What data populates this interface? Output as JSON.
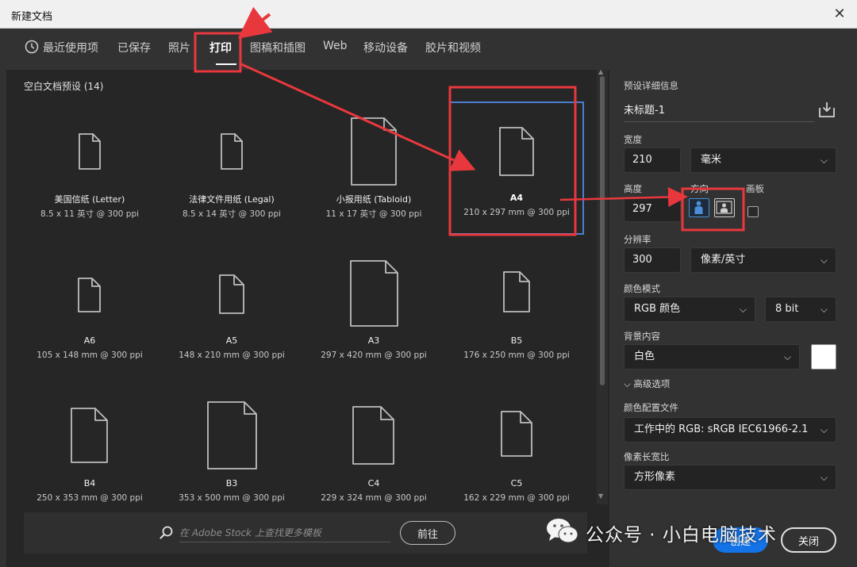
{
  "window": {
    "title": "新建文档",
    "close_glyph": "✕"
  },
  "tabs": [
    {
      "label": "最近使用项",
      "icon": "clock-icon"
    },
    {
      "label": "已保存"
    },
    {
      "label": "照片"
    },
    {
      "label": "打印",
      "active": true
    },
    {
      "label": "图稿和插图"
    },
    {
      "label": "Web"
    },
    {
      "label": "移动设备"
    },
    {
      "label": "胶片和视频"
    }
  ],
  "presets": {
    "heading": "空白文档预设 (14)",
    "items": [
      {
        "name": "美国信纸 (Letter)",
        "size": "8.5 x 11 英寸 @ 300 ppi"
      },
      {
        "name": "法律文件用纸 (Legal)",
        "size": "8.5 x 14 英寸 @ 300 ppi"
      },
      {
        "name": "小报用纸 (Tabloid)",
        "size": "11 x 17 英寸 @ 300 ppi"
      },
      {
        "name": "A4",
        "size": "210 x 297 mm @ 300 ppi",
        "selected": true
      },
      {
        "name": "A6",
        "size": "105 x 148 mm @ 300 ppi"
      },
      {
        "name": "A5",
        "size": "148 x 210 mm @ 300 ppi"
      },
      {
        "name": "A3",
        "size": "297 x 420 mm @ 300 ppi"
      },
      {
        "name": "B5",
        "size": "176 x 250 mm @ 300 ppi"
      },
      {
        "name": "B4",
        "size": "250 x 353 mm @ 300 ppi"
      },
      {
        "name": "B3",
        "size": "353 x 500 mm @ 300 ppi"
      },
      {
        "name": "C4",
        "size": "229 x 324 mm @ 300 ppi"
      },
      {
        "name": "C5",
        "size": "162 x 229 mm @ 300 ppi"
      }
    ]
  },
  "stock": {
    "placeholder": "在 Adobe Stock 上查找更多模板",
    "go_label": "前往"
  },
  "details": {
    "heading": "预设详细信息",
    "doc_name": "未标题-1",
    "width_label": "宽度",
    "width_value": "210",
    "width_unit": "毫米",
    "height_label": "高度",
    "height_value": "297",
    "orientation_label": "方向",
    "orientation_selected": "portrait",
    "artboard_label": "画板",
    "resolution_label": "分辨率",
    "resolution_value": "300",
    "resolution_unit": "像素/英寸",
    "color_mode_label": "颜色模式",
    "color_mode_value": "RGB 颜色",
    "bit_depth_value": "8 bit",
    "background_label": "背景内容",
    "background_value": "白色",
    "background_color": "#ffffff",
    "advanced_label": "高级选项",
    "color_profile_label": "颜色配置文件",
    "color_profile_value": "工作中的 RGB: sRGB IEC61966-2.1",
    "pixel_aspect_label": "像素长宽比",
    "pixel_aspect_value": "方形像素"
  },
  "buttons": {
    "create_label": "创建",
    "close_label": "关闭"
  },
  "watermark": {
    "text": "公众号 · 小白电脑技术"
  },
  "colors": {
    "accent": "#1473e6",
    "annotation_red": "#e8383d",
    "selection_blue": "#4a8ed8"
  }
}
